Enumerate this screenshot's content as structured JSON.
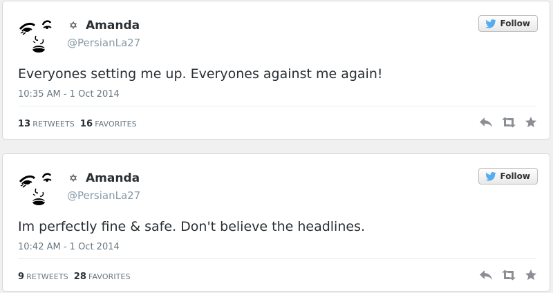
{
  "tweets": [
    {
      "author_name": "Amanda",
      "handle": "@PersianLa27",
      "follow_label": "Follow",
      "text": "Everyones setting me up. Everyones against me again!",
      "timestamp": "10:35 AM - 1 Oct 2014",
      "retweets_count": "13",
      "retweets_label": "RETWEETS",
      "favorites_count": "16",
      "favorites_label": "FAVORITES"
    },
    {
      "author_name": "Amanda",
      "handle": "@PersianLa27",
      "follow_label": "Follow",
      "text": "Im perfectly fine & safe. Don't believe the headlines.",
      "timestamp": "10:42 AM - 1 Oct 2014",
      "retweets_count": "9",
      "retweets_label": "RETWEETS",
      "favorites_count": "28",
      "favorites_label": "FAVORITES"
    }
  ],
  "icons": {
    "name_badge": "star-of-david-icon",
    "follow": "twitter-bird-icon",
    "reply": "reply-icon",
    "retweet": "retweet-icon",
    "favorite": "star-icon"
  },
  "colors": {
    "twitter_blue": "#55acee",
    "action_gray": "#8b8f93",
    "muted_text": "#66757f"
  }
}
